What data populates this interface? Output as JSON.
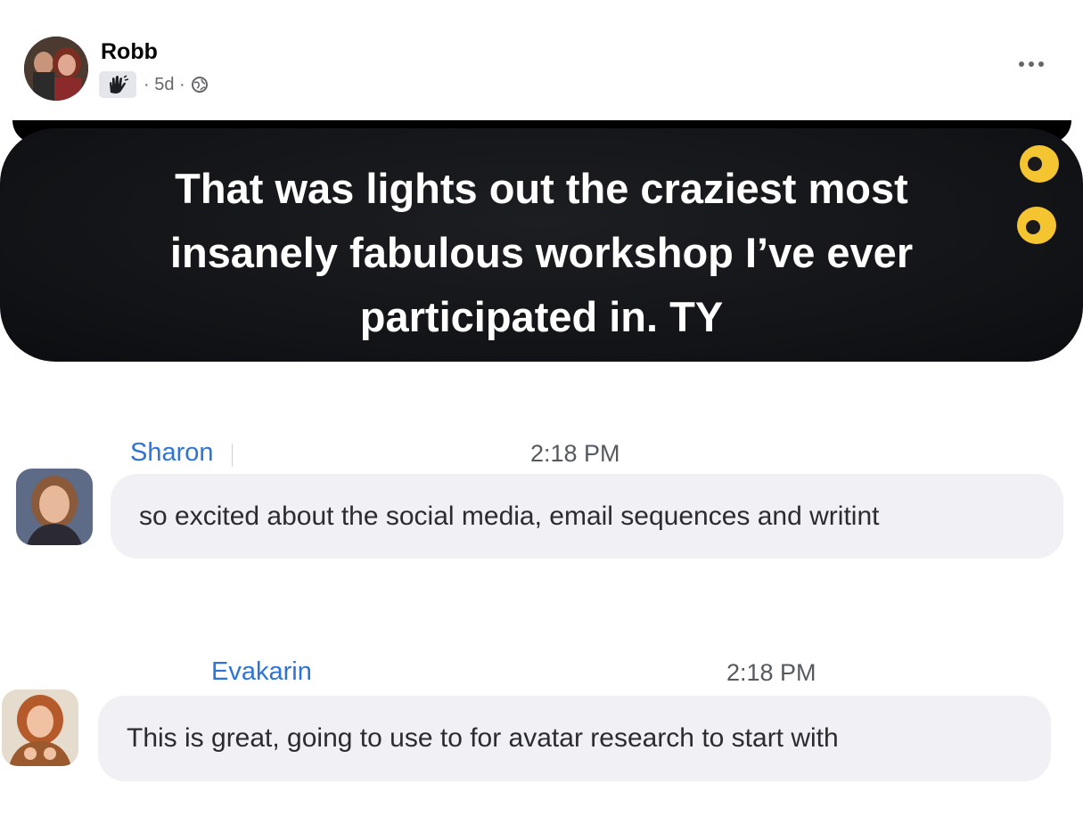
{
  "post": {
    "author": "Robb",
    "time": "· 5d ·",
    "badge_icon": "raised-hand-icon",
    "visibility_icon": "globe-icon",
    "more_icon": "more-dots-icon"
  },
  "banner": {
    "text": "That was lights out the craziest most insanely fabulous workshop I’ve ever participated in. TY",
    "emoji": "eyes-emoji"
  },
  "chat": {
    "messages": [
      {
        "sender": "Sharon",
        "time": "2:18 PM",
        "text": "so excited about the social media, email sequences and writint"
      },
      {
        "sender": "Evakarin",
        "time": "2:18 PM",
        "text": "This is great, going to use to for avatar research to start with"
      }
    ]
  },
  "colors": {
    "sender_name": "#2d74d6",
    "bubble_bg": "#f1f1f5",
    "banner_bg": "#111316",
    "meta_gray": "#65676b"
  }
}
